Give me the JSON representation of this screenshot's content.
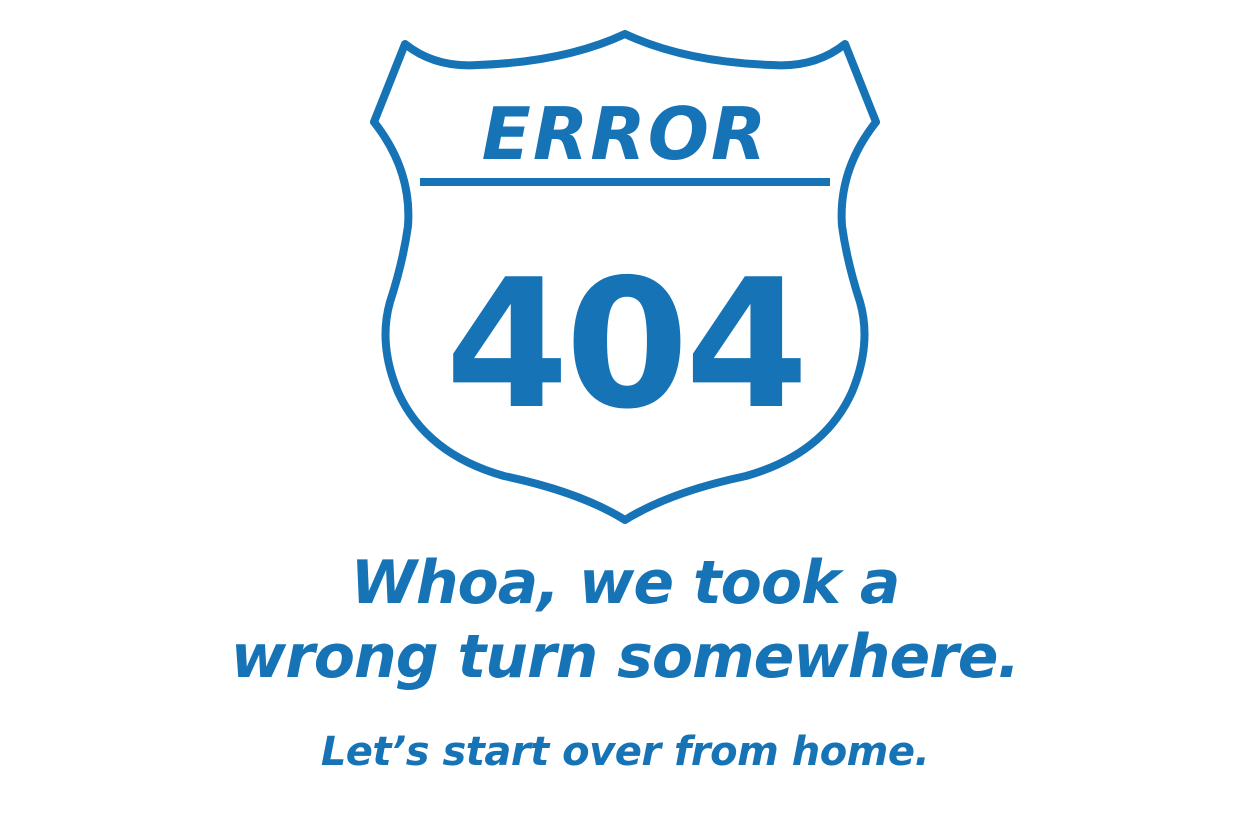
{
  "sign": {
    "top_label": "ERROR",
    "code": "404"
  },
  "message": {
    "line1": "Whoa, we took a",
    "line2": "wrong turn somewhere.",
    "subtext": "Let’s start over from home."
  },
  "colors": {
    "brand_blue": "#1673b6",
    "background": "#ffffff"
  }
}
